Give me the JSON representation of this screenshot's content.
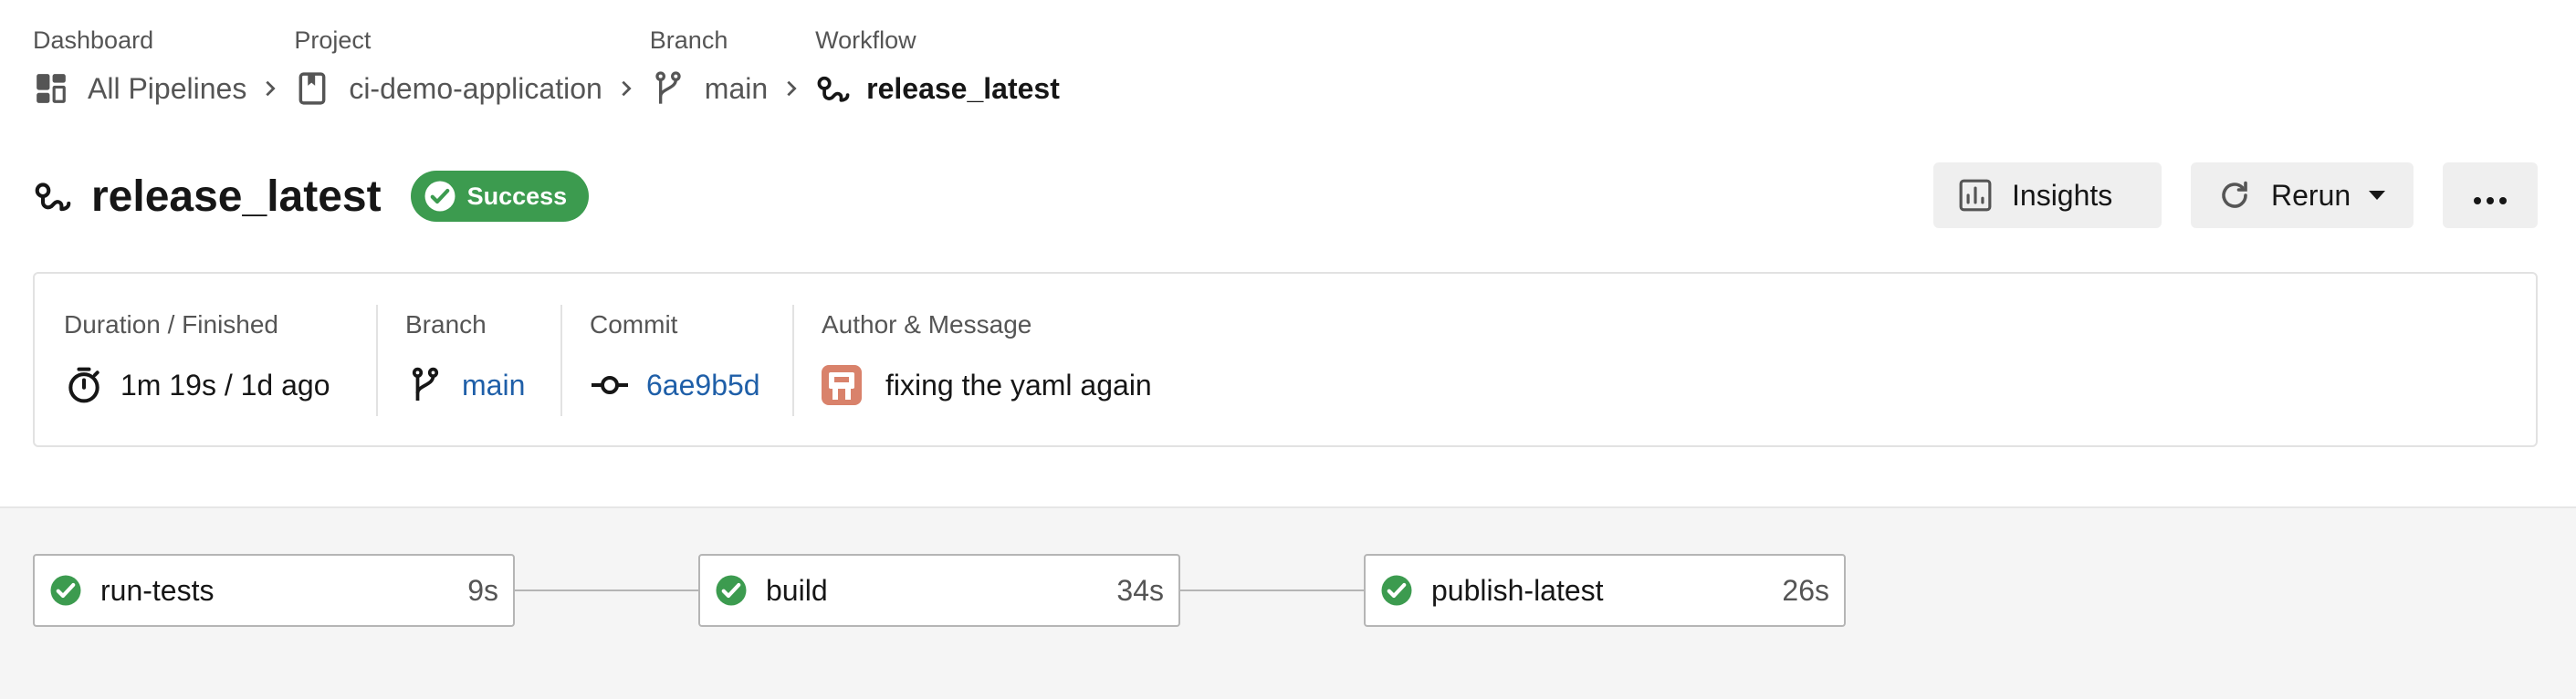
{
  "breadcrumb": {
    "dashboard": {
      "label": "Dashboard",
      "value": "All Pipelines",
      "icon": "dashboard-icon"
    },
    "project": {
      "label": "Project",
      "value": "ci-demo-application",
      "icon": "repository-icon"
    },
    "branch": {
      "label": "Branch",
      "value": "main",
      "icon": "branch-icon"
    },
    "workflow": {
      "label": "Workflow",
      "value": "release_latest",
      "icon": "workflow-icon"
    }
  },
  "header": {
    "title": "release_latest",
    "status": "Success",
    "status_color": "#3c9b4f",
    "insights_label": "Insights",
    "rerun_label": "Rerun"
  },
  "details": {
    "duration": {
      "label": "Duration / Finished",
      "value": "1m 19s / 1d ago"
    },
    "branch": {
      "label": "Branch",
      "value": "main"
    },
    "commit": {
      "label": "Commit",
      "value": "6ae9b5d"
    },
    "author": {
      "label": "Author & Message",
      "message": "fixing the yaml again"
    }
  },
  "jobs": [
    {
      "name": "run-tests",
      "duration": "9s",
      "status": "success"
    },
    {
      "name": "build",
      "duration": "34s",
      "status": "success"
    },
    {
      "name": "publish-latest",
      "duration": "26s",
      "status": "success"
    }
  ],
  "colors": {
    "accent_link": "#1f5fa8",
    "success": "#3c9b4f",
    "avatar": "#d9826b"
  }
}
